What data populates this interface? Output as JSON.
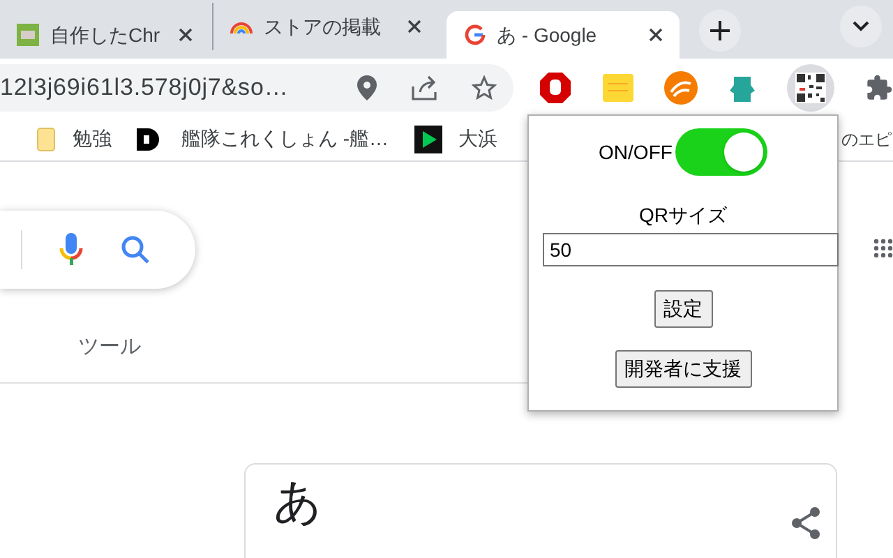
{
  "tabs": [
    {
      "title": "自作したChr",
      "selected": false
    },
    {
      "title": "ストアの掲載",
      "selected": false
    },
    {
      "title": "あ - Google",
      "selected": true
    }
  ],
  "address_bar": {
    "url": "12l3j69i61l3.578j0j7&so…"
  },
  "bookmarks": [
    {
      "kind": "folder",
      "label": "勉強"
    },
    {
      "kind": "d",
      "label": "艦隊これくしょん -艦…"
    },
    {
      "kind": "play",
      "label": "大浜"
    },
    {
      "kind": "none",
      "label": "のエピ"
    }
  ],
  "search_tabs": [
    "ツール"
  ],
  "result_card": {
    "title": "あ"
  },
  "popup": {
    "toggle_label": "ON/OFF",
    "on": true,
    "size_label": "QRサイズ",
    "size_value": "50",
    "buttons": [
      "設定",
      "開発者に支援"
    ]
  }
}
